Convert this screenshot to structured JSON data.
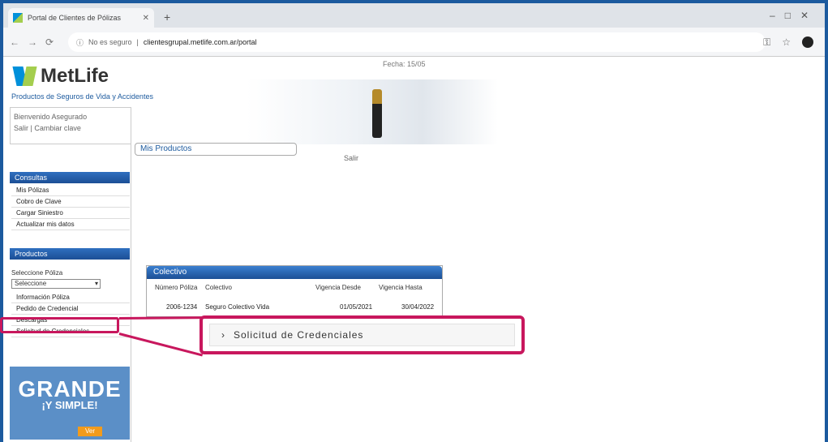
{
  "browser": {
    "tab_title": "Portal de Clientes de Pólizas",
    "url_prefix": "No es seguro",
    "url": "clientesgrupal.metlife.com.ar/portal"
  },
  "header": {
    "brand": "MetLife",
    "tagline": "Productos de Seguros de Vida y Accidentes",
    "user_line1": "Bienvenido Asegurado",
    "user_line2": "Salir | Cambiar clave",
    "fecha": "Fecha: 15/05"
  },
  "content": {
    "mis_productos": "Mis Productos",
    "salir": "Salir"
  },
  "sidebar": {
    "section1_title": "Consultas",
    "section1_items": [
      "Mis Pólizas",
      "Cobro de Clave",
      "Cargar Siniestro",
      "Actualizar mis datos"
    ],
    "section2_title": "Productos",
    "select_label": "Seleccione Póliza",
    "select_value": "Seleccione",
    "section2_items": [
      "Información Póliza",
      "Pedido de Credencial",
      "Descargas",
      "Solicitud de Credenciales"
    ],
    "promo_big": "GRANDE",
    "promo_small": "¡Y SIMPLE!",
    "promo_badge": "Ver"
  },
  "panel": {
    "title": "Colectivo",
    "columns": [
      "Número Póliza",
      "Colectivo",
      "Vigencia Desde",
      "Vigencia Hasta"
    ],
    "row": [
      "2006-1234",
      "Seguro Colectivo Vida",
      "01/05/2021",
      "30/04/2022"
    ]
  },
  "callout": {
    "text": "Solicitud de Credenciales"
  }
}
